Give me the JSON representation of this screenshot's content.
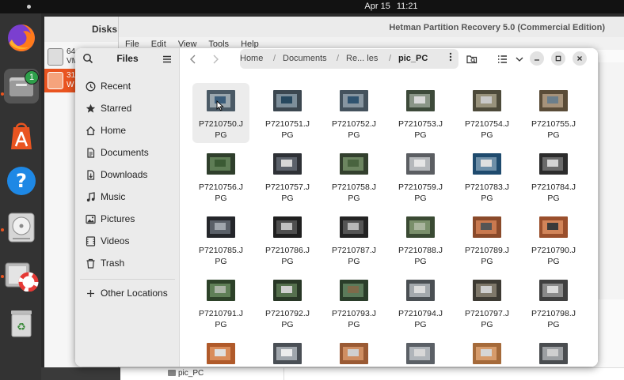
{
  "topbar": {
    "date": "Apr 15",
    "time": "11:21"
  },
  "dock": {
    "items": [
      {
        "name": "firefox-icon"
      },
      {
        "name": "files-icon",
        "badge": "1"
      },
      {
        "name": "app-center-icon"
      },
      {
        "name": "help-icon"
      },
      {
        "name": "disks-icon"
      },
      {
        "name": "hetman-recovery-icon"
      },
      {
        "name": "trash-icon"
      }
    ]
  },
  "background_app": {
    "disks_title": "Disks",
    "disk_entries": [
      {
        "line1": "64",
        "line2": "VM"
      },
      {
        "line1": "31",
        "line2": "W"
      }
    ],
    "recovery_title": "Hetman Partition Recovery 5.0 (Commercial Edition)",
    "menu": [
      "File",
      "Edit",
      "View",
      "Tools",
      "Help"
    ],
    "lower_folder": "pic_PC"
  },
  "files": {
    "sidebar": {
      "title": "Files",
      "items": [
        {
          "label": "Recent",
          "icon": "clock-icon"
        },
        {
          "label": "Starred",
          "icon": "star-icon"
        },
        {
          "label": "Home",
          "icon": "home-icon"
        },
        {
          "label": "Documents",
          "icon": "document-icon"
        },
        {
          "label": "Downloads",
          "icon": "download-icon"
        },
        {
          "label": "Music",
          "icon": "music-icon"
        },
        {
          "label": "Pictures",
          "icon": "pictures-icon"
        },
        {
          "label": "Videos",
          "icon": "video-icon"
        },
        {
          "label": "Trash",
          "icon": "trash-icon"
        }
      ],
      "other_locations": "Other Locations"
    },
    "path": {
      "home": "Home",
      "documents": "Documents",
      "middle": "Re... les",
      "current": "pic_PC",
      "sep": "/"
    },
    "files": [
      {
        "n1": "P7210750.J",
        "n2": "PG",
        "c1": "#4b5a66",
        "c2": "#9aa6ae",
        "c3": "#3a5c7a"
      },
      {
        "n1": "P7210751.J",
        "n2": "PG",
        "c1": "#3c4750",
        "c2": "#7d8e9a",
        "c3": "#27485f"
      },
      {
        "n1": "P7210752.J",
        "n2": "PG",
        "c1": "#44525d",
        "c2": "#8795a0",
        "c3": "#2f5370"
      },
      {
        "n1": "P7210753.J",
        "n2": "PG",
        "c1": "#3d4a3a",
        "c2": "#8a9587",
        "c3": "#d9d9d9"
      },
      {
        "n1": "P7210754.J",
        "n2": "PG",
        "c1": "#4d4a3a",
        "c2": "#98927c",
        "c3": "#c8c8c8"
      },
      {
        "n1": "P7210755.J",
        "n2": "PG",
        "c1": "#5a4c38",
        "c2": "#a6927a",
        "c3": "#6b7e8b"
      },
      {
        "n1": "P7210756.J",
        "n2": "PG",
        "c1": "#2f3f2c",
        "c2": "#5e7d55",
        "c3": "#3b5b34"
      },
      {
        "n1": "P7210757.J",
        "n2": "PG",
        "c1": "#2e3136",
        "c2": "#5b616a",
        "c3": "#d7d7d7"
      },
      {
        "n1": "P7210758.J",
        "n2": "PG",
        "c1": "#33402e",
        "c2": "#6c8560",
        "c3": "#49643f"
      },
      {
        "n1": "P7210759.J",
        "n2": "PG",
        "c1": "#5b5e62",
        "c2": "#b5b8bb",
        "c3": "#e6e6e6"
      },
      {
        "n1": "P7210783.J",
        "n2": "PG",
        "c1": "#1f4b6e",
        "c2": "#6e8fa8",
        "c3": "#e0e0e0"
      },
      {
        "n1": "P7210784.J",
        "n2": "PG",
        "c1": "#2c2c2c",
        "c2": "#6a6a6a",
        "c3": "#d4d4d4"
      },
      {
        "n1": "P7210785.J",
        "n2": "PG",
        "c1": "#24262a",
        "c2": "#5a6068",
        "c3": "#a0a6ad"
      },
      {
        "n1": "P7210786.J",
        "n2": "PG",
        "c1": "#1f1f1f",
        "c2": "#4f4f4f",
        "c3": "#c0c0c0"
      },
      {
        "n1": "P7210787.J",
        "n2": "PG",
        "c1": "#232323",
        "c2": "#555555",
        "c3": "#b8b8b8"
      },
      {
        "n1": "P7210788.J",
        "n2": "PG",
        "c1": "#3a4a33",
        "c2": "#7a8f6b",
        "c3": "#aab59e"
      },
      {
        "n1": "P7210789.J",
        "n2": "PG",
        "c1": "#8a4a2a",
        "c2": "#c9794f",
        "c3": "#555555"
      },
      {
        "n1": "P7210790.J",
        "n2": "PG",
        "c1": "#9a4f2c",
        "c2": "#d18459",
        "c3": "#3a3a3a"
      },
      {
        "n1": "P7210791.J",
        "n2": "PG",
        "c1": "#2d4229",
        "c2": "#5f7f57",
        "c3": "#aab4a6"
      },
      {
        "n1": "P7210792.J",
        "n2": "PG",
        "c1": "#283726",
        "c2": "#55704e",
        "c3": "#cfcfcf"
      },
      {
        "n1": "P7210793.J",
        "n2": "PG",
        "c1": "#2a3d2a",
        "c2": "#5b7a5a",
        "c3": "#7e6a4a"
      },
      {
        "n1": "P7210794.J",
        "n2": "PG",
        "c1": "#4a4f53",
        "c2": "#a3a8ac",
        "c3": "#dcdcdc"
      },
      {
        "n1": "P7210797.J",
        "n2": "PG",
        "c1": "#3d3a33",
        "c2": "#7f786a",
        "c3": "#cfcfcf"
      },
      {
        "n1": "P7210798.J",
        "n2": "PG",
        "c1": "#3f3f3f",
        "c2": "#8a8a8a",
        "c3": "#d9d9d9"
      },
      {
        "n1": "",
        "n2": "",
        "c1": "#b05a2a",
        "c2": "#d98c5a",
        "c3": "#e0e0e0"
      },
      {
        "n1": "",
        "n2": "",
        "c1": "#4a4f55",
        "c2": "#a0a6ac",
        "c3": "#ececec"
      },
      {
        "n1": "",
        "n2": "",
        "c1": "#9a5a34",
        "c2": "#cf8e62",
        "c3": "#d0d0d0"
      },
      {
        "n1": "",
        "n2": "",
        "c1": "#5b6066",
        "c2": "#b0b5ba",
        "c3": "#d8d8d8"
      },
      {
        "n1": "",
        "n2": "",
        "c1": "#a56a3a",
        "c2": "#d69b6b",
        "c3": "#d6d6d6"
      },
      {
        "n1": "",
        "n2": "",
        "c1": "#4a4d50",
        "c2": "#9c9fa2",
        "c3": "#cfcfcf"
      }
    ]
  }
}
